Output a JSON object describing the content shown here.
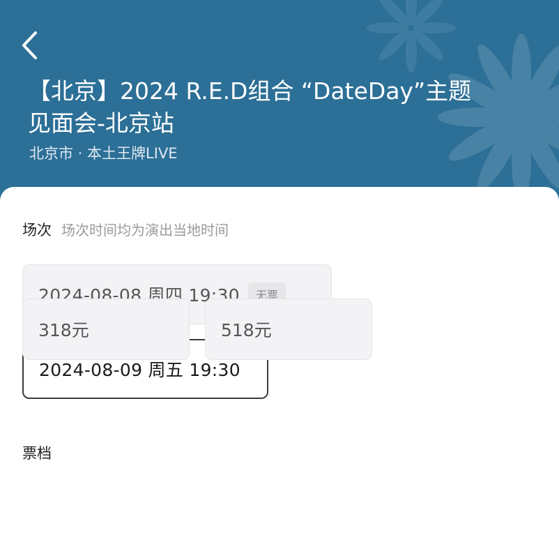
{
  "header": {
    "title_line1": "【北京】2024 R.E.D组合 “DateDay”主题",
    "title_line2": "见面会-北京站",
    "subtitle": "北京市 · 本土王牌LIVE",
    "background_color": "#2c6f97"
  },
  "sessions_section": {
    "label": "场次",
    "hint": "场次时间均为演出当地时间",
    "items": [
      {
        "text": "2024-08-08  周四 19:30",
        "badge": "无票",
        "state": "sold-out"
      },
      {
        "text": "2024-08-09 周五 19:30",
        "badge": "",
        "state": "selected"
      }
    ]
  },
  "tickets_section": {
    "label": "票档",
    "items": [
      {
        "price": "318元"
      },
      {
        "price": "518元"
      }
    ]
  },
  "icons": {
    "back": "chevron-left-icon",
    "decoration": "flower-pattern-icon"
  }
}
